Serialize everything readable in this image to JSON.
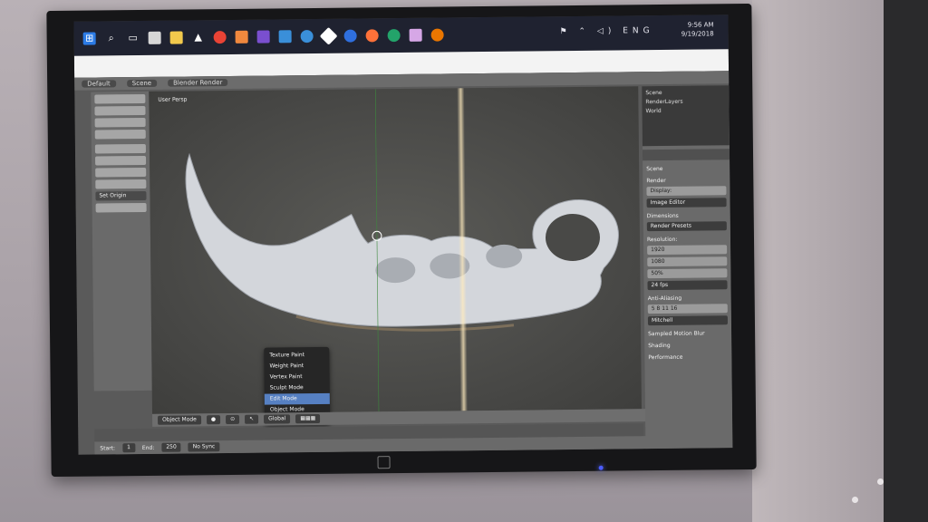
{
  "taskbar": {
    "time": "9:56 AM",
    "date": "9/19/2018",
    "language": "ENG"
  },
  "infobar": {
    "layout": "Default",
    "scene": "Scene",
    "renderer": "Blender Render"
  },
  "toolshelf": {
    "set_origin": "Set Origin"
  },
  "viewport": {
    "view_label": "User Persp",
    "mode_menu": {
      "items": [
        "Texture Paint",
        "Weight Paint",
        "Vertex Paint",
        "Sculpt Mode",
        "Edit Mode",
        "Object Mode"
      ],
      "selected_index": 4
    },
    "header": {
      "mode": "Object Mode",
      "orientation": "Global"
    }
  },
  "timeline": {
    "start_label": "Start:",
    "start": "1",
    "end_label": "End:",
    "end": "250",
    "sync": "No Sync"
  },
  "properties": {
    "outliner": [
      "Scene",
      "RenderLayers",
      "World"
    ],
    "scene_label": "Scene",
    "render_header": "Render",
    "display": "Display:",
    "display_value": "Image Editor",
    "dimensions": "Dimensions",
    "preset": "Render Presets",
    "resolution": "Resolution:",
    "res_x": "1920",
    "res_y": "1080",
    "res_pct": "50%",
    "frame_rate": "24 fps",
    "anti_aliasing": "Anti-Aliasing",
    "aa_value": "Mitchell",
    "aa_samples": "5 8 11 16",
    "sampled_motion_blur": "Sampled Motion Blur",
    "shading": "Shading",
    "performance": "Performance"
  },
  "colors": {
    "taskbar": "#1f2230",
    "viewport": "#474745",
    "model": "#d3d6db",
    "menu_selected": "#5680c2"
  }
}
